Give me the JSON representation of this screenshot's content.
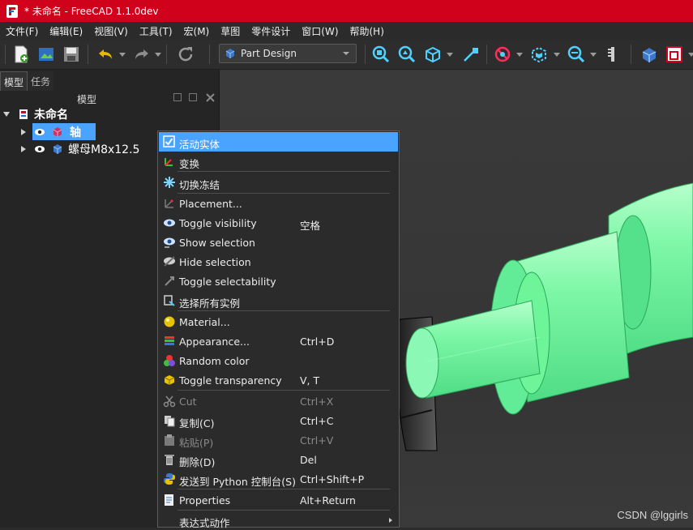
{
  "window": {
    "title": "* 未命名 - FreeCAD 1.1.0dev",
    "accent": "#d0021b"
  },
  "menubar": [
    "文件(F)",
    "编辑(E)",
    "视图(V)",
    "工具(T)",
    "宏(M)",
    "草图",
    "零件设计",
    "窗口(W)",
    "帮助(H)"
  ],
  "toolbar": {
    "workbench": "Part Design"
  },
  "leftpanel": {
    "tabs": [
      "模型",
      "任务"
    ],
    "header": "模型",
    "tree": {
      "root": "未命名",
      "items": [
        "轴",
        "螺母M8x12.5"
      ]
    }
  },
  "context_menu": {
    "items": [
      {
        "label": "活动实体",
        "shortcut": "",
        "icon": "checkbox-icon"
      },
      {
        "label": "变换",
        "shortcut": "",
        "icon": "transform-icon"
      },
      {
        "label": "切换冻结",
        "shortcut": "",
        "icon": "snowflake-icon"
      },
      {
        "label": "Placement...",
        "shortcut": "",
        "icon": "placement-icon"
      },
      {
        "label": "Toggle visibility",
        "shortcut": "空格",
        "icon": "eye-icon"
      },
      {
        "label": "Show selection",
        "shortcut": "",
        "icon": "show-selection-icon"
      },
      {
        "label": "Hide selection",
        "shortcut": "",
        "icon": "hide-selection-icon"
      },
      {
        "label": "Toggle selectability",
        "shortcut": "",
        "icon": "cursor-icon"
      },
      {
        "label": "选择所有实例",
        "shortcut": "",
        "icon": "select-instances-icon"
      },
      {
        "label": "Material...",
        "shortcut": "",
        "icon": "material-icon"
      },
      {
        "label": "Appearance...",
        "shortcut": "Ctrl+D",
        "icon": "appearance-icon"
      },
      {
        "label": "Random color",
        "shortcut": "",
        "icon": "random-color-icon"
      },
      {
        "label": "Toggle transparency",
        "shortcut": "V, T",
        "icon": "transparency-icon"
      },
      {
        "label": "Cut",
        "shortcut": "Ctrl+X",
        "icon": "scissors-icon"
      },
      {
        "label": "复制(C)",
        "shortcut": "Ctrl+C",
        "icon": "copy-icon"
      },
      {
        "label": "粘贴(P)",
        "shortcut": "Ctrl+V",
        "icon": "paste-icon"
      },
      {
        "label": "删除(D)",
        "shortcut": "Del",
        "icon": "trash-icon"
      },
      {
        "label": "发送到 Python 控制台(S)",
        "shortcut": "Ctrl+Shift+P",
        "icon": "python-icon"
      },
      {
        "label": "Properties",
        "shortcut": "Alt+Return",
        "icon": "properties-icon"
      },
      {
        "label": "表达式动作",
        "shortcut": "",
        "icon": ""
      }
    ]
  },
  "watermark": "CSDN @lggirls",
  "colors": {
    "highlight": "#4aa3ff",
    "part_green": "#6ef59a"
  }
}
